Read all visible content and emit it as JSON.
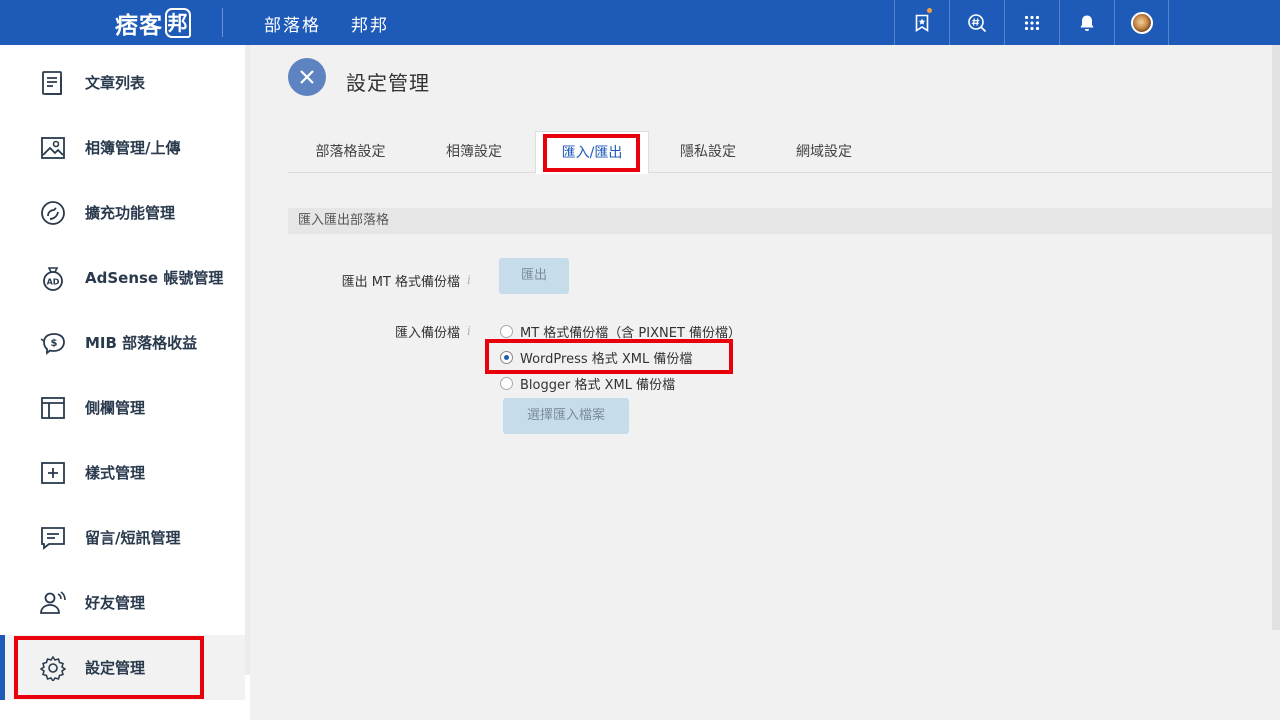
{
  "topbar": {
    "logo": "痞客",
    "logo_badge": "邦",
    "nav": [
      "部落格",
      "邦邦"
    ],
    "icons": [
      "bookmark-star-icon",
      "hashtag-search-icon",
      "apps-grid-icon",
      "bell-icon",
      "avatar"
    ]
  },
  "sidebar": {
    "items": [
      {
        "label": "文章列表",
        "icon": "article-list-icon"
      },
      {
        "label": "相簿管理/上傳",
        "icon": "photo-album-icon"
      },
      {
        "label": "擴充功能管理",
        "icon": "extension-icon"
      },
      {
        "label": "AdSense 帳號管理",
        "icon": "adsense-bag-icon"
      },
      {
        "label": "MIB 部落格收益",
        "icon": "piggy-bank-icon"
      },
      {
        "label": "側欄管理",
        "icon": "sidebar-layout-icon"
      },
      {
        "label": "樣式管理",
        "icon": "style-plus-icon"
      },
      {
        "label": "留言/短訊管理",
        "icon": "message-icon"
      },
      {
        "label": "好友管理",
        "icon": "friends-icon"
      },
      {
        "label": "設定管理",
        "icon": "gear-icon"
      }
    ]
  },
  "main": {
    "title": "設定管理",
    "tabs": [
      {
        "label": "部落格設定"
      },
      {
        "label": "相簿設定"
      },
      {
        "label": "匯入/匯出"
      },
      {
        "label": "隱私設定"
      },
      {
        "label": "網域設定"
      }
    ],
    "active_tab": "匯入/匯出",
    "section_title": "匯入匯出部落格",
    "export": {
      "label": "匯出 MT 格式備份檔",
      "info": "i",
      "button": "匯出"
    },
    "import": {
      "label": "匯入備份檔",
      "info": "i",
      "options": [
        {
          "label": "MT 格式備份檔（含 PIXNET 備份檔）",
          "checked": false
        },
        {
          "label": "WordPress 格式 XML 備份檔",
          "checked": true
        },
        {
          "label": "Blogger 格式 XML 備份檔",
          "checked": false
        }
      ],
      "button": "選擇匯入檔案"
    }
  },
  "colors": {
    "brand": "#1e5bb8",
    "highlight": "#e8000b",
    "button_light": "#c7dcea"
  }
}
